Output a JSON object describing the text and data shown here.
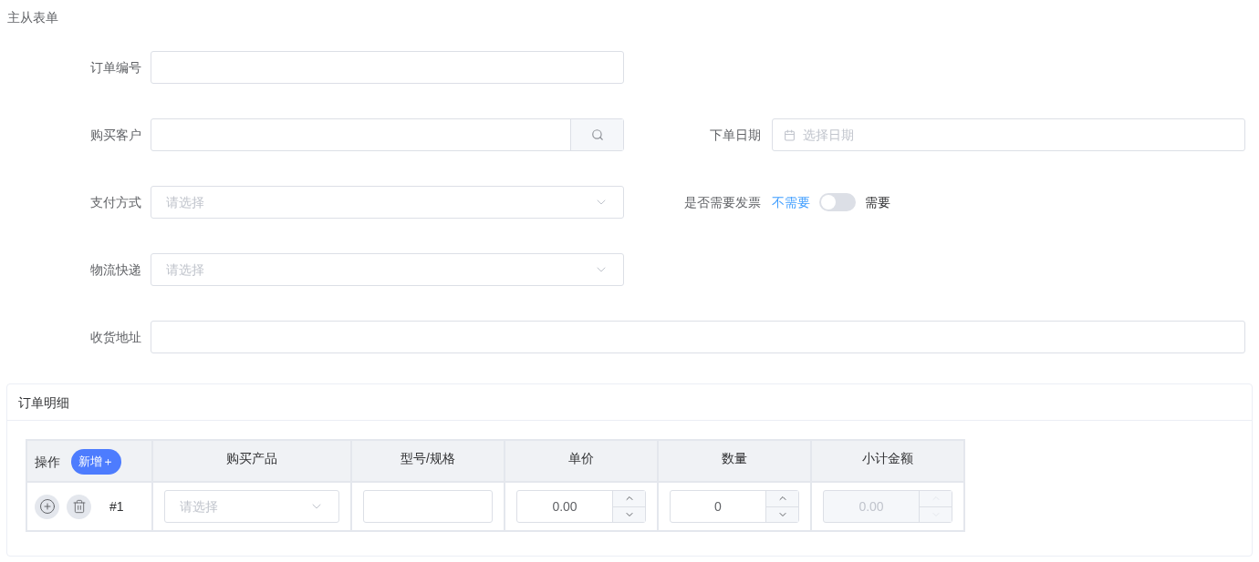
{
  "title": "主从表单",
  "form_rows": [
    [
      {
        "kind": "text",
        "label": "订单编号"
      }
    ],
    [
      {
        "kind": "search",
        "label": "购买客户"
      },
      {
        "kind": "date",
        "label": "下单日期",
        "placeholder": "选择日期"
      }
    ],
    [
      {
        "kind": "select",
        "label": "支付方式",
        "placeholder": "请选择"
      },
      {
        "kind": "switch",
        "label": "是否需要发票",
        "off_text": "不需要",
        "on_text": "需要",
        "on": false
      }
    ],
    [
      {
        "kind": "select",
        "label": "物流快递",
        "placeholder": "请选择"
      }
    ],
    [
      {
        "kind": "wide",
        "label": "收货地址"
      }
    ]
  ],
  "detail": {
    "title": "订单明细",
    "columns": [
      {
        "label": "操作",
        "add_button": "新增＋"
      },
      {
        "label": "购买产品"
      },
      {
        "label": "型号/规格"
      },
      {
        "label": "单价"
      },
      {
        "label": "数量"
      },
      {
        "label": "小计金额"
      }
    ],
    "rows": [
      {
        "cells": [
          {
            "kind": "actions",
            "index": "#1"
          },
          {
            "kind": "select",
            "placeholder": "请选择"
          },
          {
            "kind": "text"
          },
          {
            "kind": "number",
            "value": "0.00",
            "disabled": false
          },
          {
            "kind": "number",
            "value": "0",
            "disabled": false
          },
          {
            "kind": "number",
            "value": "0.00",
            "disabled": true
          }
        ]
      }
    ]
  }
}
